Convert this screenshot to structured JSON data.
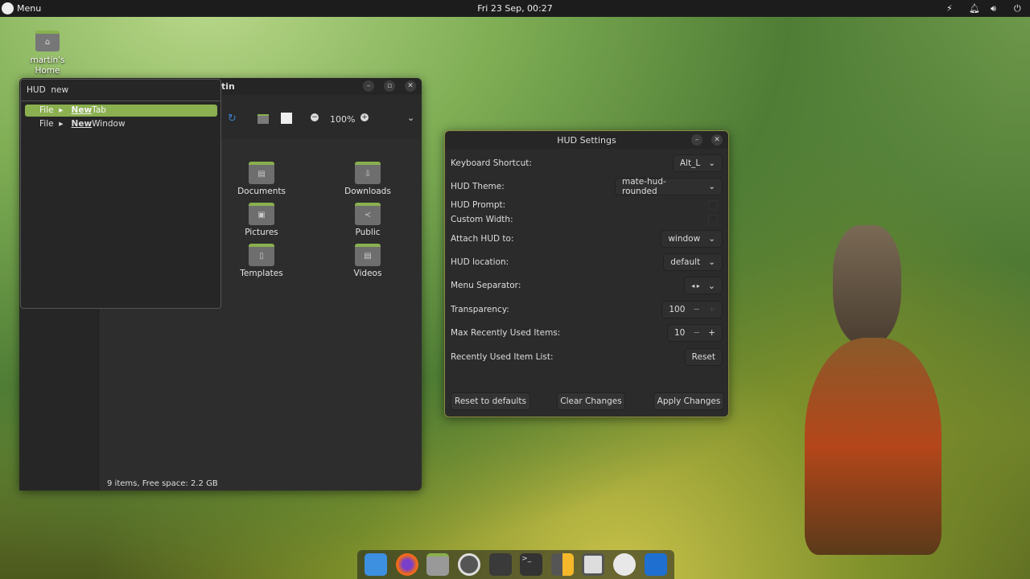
{
  "panel": {
    "menu_label": "Menu",
    "clock": "Fri 23 Sep, 00:27"
  },
  "desktop": {
    "home_icon_label": "martin's Home"
  },
  "file_manager": {
    "title": "tin",
    "zoom": "100%",
    "folders": [
      "Documents",
      "Downloads",
      "Pictures",
      "Public",
      "Templates",
      "Videos"
    ],
    "status": "9 items, Free space: 2.2 GB"
  },
  "hud": {
    "query": "HUD  new",
    "results": [
      {
        "menu": "File",
        "match": "New",
        "rest": "Tab",
        "selected": true
      },
      {
        "menu": "File",
        "match": "New",
        "rest": "Window",
        "selected": false
      }
    ],
    "accent": "#8ab04f"
  },
  "settings": {
    "title": "HUD Settings",
    "keyboard_shortcut": {
      "label": "Keyboard Shortcut:",
      "value": "Alt_L"
    },
    "hud_theme": {
      "label": "HUD Theme:",
      "value": "mate-hud-rounded"
    },
    "hud_prompt": {
      "label": "HUD Prompt:",
      "checked": false
    },
    "custom_width": {
      "label": "Custom Width:",
      "checked": false
    },
    "attach": {
      "label": "Attach HUD to:",
      "value": "window"
    },
    "location": {
      "label": "HUD location:",
      "value": "default"
    },
    "separator": {
      "label": "Menu Separator:",
      "value": "◂ ▸"
    },
    "transparency": {
      "label": "Transparency:",
      "value": "100"
    },
    "max_recent": {
      "label": "Max Recently Used Items:",
      "value": "10"
    },
    "recent_list": {
      "label": "Recently Used Item List:",
      "button": "Reset"
    },
    "buttons": {
      "reset_defaults": "Reset to defaults",
      "clear": "Clear Changes",
      "apply": "Apply Changes"
    }
  },
  "dock": [
    "file-manager-blue",
    "firefox",
    "files",
    "settings",
    "system-monitor",
    "terminal",
    "calculator",
    "text-editor",
    "clock",
    "trash"
  ]
}
